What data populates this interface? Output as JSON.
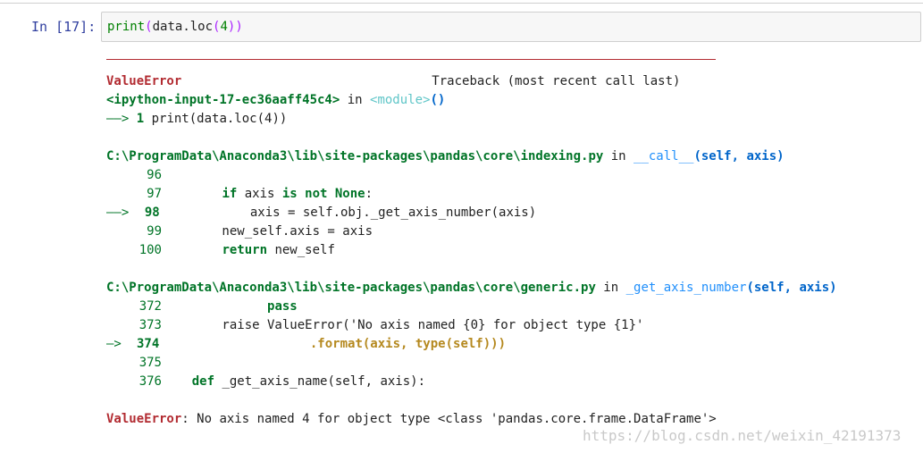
{
  "prompt": "In [17]:",
  "input": {
    "fn": "print",
    "open": "(",
    "obj": "data",
    "dot": ".",
    "attr": "loc",
    "arg": "4",
    "close": ")"
  },
  "traceback": {
    "error_name": "ValueError",
    "header_right": "Traceback (most recent call last)",
    "frame0": {
      "file": "<ipython-input-17-ec36aaff45c4>",
      "in": " in ",
      "func": "<module>",
      "parens": "()",
      "arrow": "——> ",
      "line_no": "1",
      "code": " print(data.loc(4))"
    },
    "frame1": {
      "file": "C:\\ProgramData\\Anaconda3\\lib\\site-packages\\pandas\\core\\indexing.py",
      "in": " in ",
      "func": "__call__",
      "args": "(self, axis)",
      "lines": [
        {
          "n": "96",
          "code": ""
        },
        {
          "n": "97",
          "code_prefix": "        ",
          "code_kw": "if",
          "code_rest": " axis ",
          "code_kw2": "is not None",
          "code_tail": ":"
        },
        {
          "n": "98",
          "arrow": "——> ",
          "code": "            axis = self.obj._get_axis_number(axis)"
        },
        {
          "n": "99",
          "code": "        new_self.axis = axis"
        },
        {
          "n": "100",
          "code_kw": "return",
          "code_rest": " new_self"
        }
      ]
    },
    "frame2": {
      "file": "C:\\ProgramData\\Anaconda3\\lib\\site-packages\\pandas\\core\\generic.py",
      "in": " in ",
      "func": "_get_axis_number",
      "args": "(self, axis)",
      "lines": [
        {
          "n": "372",
          "code_kw": "pass"
        },
        {
          "n": "373",
          "code": "        raise ValueError('No axis named {0} for object type {1}'"
        },
        {
          "n": "374",
          "arrow": "—> ",
          "code": "                    .format(axis, type(self)))"
        },
        {
          "n": "375",
          "code": ""
        },
        {
          "n": "376",
          "code_kw": "def",
          "code_rest": " _get_axis_name(self, axis):"
        }
      ]
    },
    "final": {
      "error_name": "ValueError",
      "message": ": No axis named 4 for object type <class 'pandas.core.frame.DataFrame'>"
    }
  },
  "watermark": "https://blog.csdn.net/weixin_42191373"
}
